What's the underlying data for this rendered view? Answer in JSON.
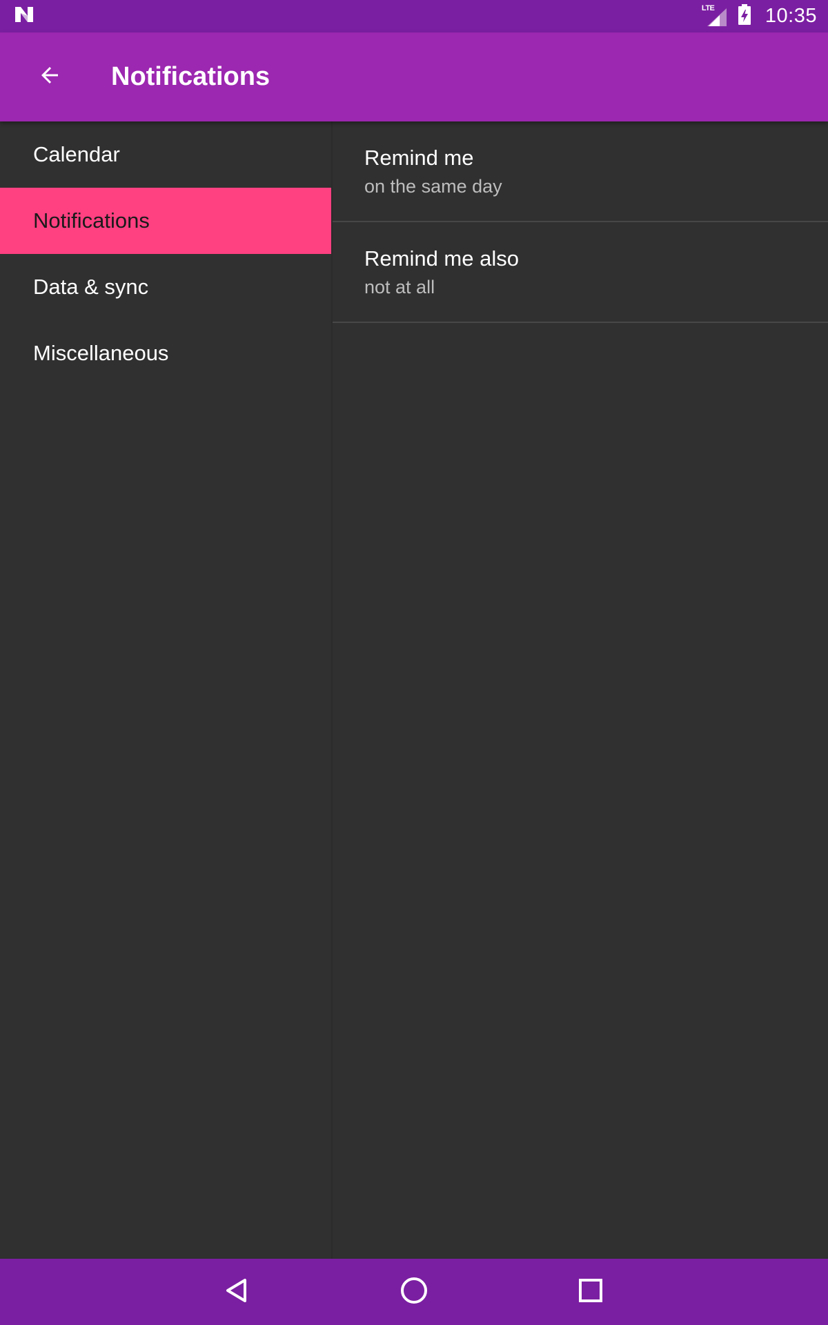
{
  "status_bar": {
    "network_label": "LTE",
    "time": "10:35",
    "icons": [
      "android-n-icon",
      "lte-signal-icon",
      "battery-charging-icon"
    ]
  },
  "app_bar": {
    "title": "Notifications",
    "back_icon": "arrow-back-icon"
  },
  "sidebar": {
    "items": [
      {
        "label": "Calendar",
        "active": false
      },
      {
        "label": "Notifications",
        "active": true
      },
      {
        "label": "Data & sync",
        "active": false
      },
      {
        "label": "Miscellaneous",
        "active": false
      }
    ]
  },
  "preferences": [
    {
      "title": "Remind me",
      "summary": "on the same day"
    },
    {
      "title": "Remind me also",
      "summary": "not at all"
    }
  ],
  "nav_bar": {
    "icons": [
      "back-triangle-icon",
      "home-circle-icon",
      "recents-square-icon"
    ]
  },
  "colors": {
    "status_bar": "#7b1fa2",
    "app_bar": "#9c27b0",
    "accent": "#ff4081",
    "background": "#303030",
    "nav_bar": "#7b1fa2"
  }
}
